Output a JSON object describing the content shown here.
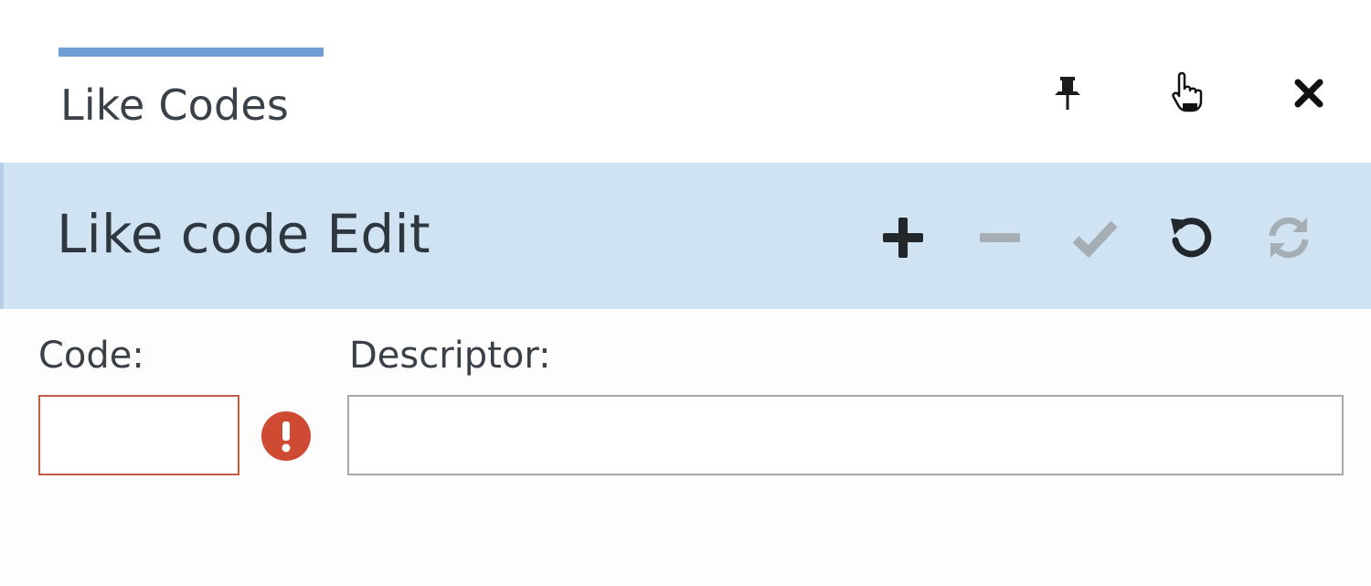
{
  "tab": {
    "label": "Like Codes",
    "accent_color": "#6e9fd3"
  },
  "window_controls": [
    {
      "name": "pin-icon"
    },
    {
      "name": "hand-cursor-icon"
    },
    {
      "name": "close-icon"
    }
  ],
  "panel": {
    "title": "Like code Edit",
    "background": "#cfe3f3",
    "toolbar": [
      {
        "name": "add-icon",
        "enabled": true
      },
      {
        "name": "remove-icon",
        "enabled": false
      },
      {
        "name": "save-check-icon",
        "enabled": false
      },
      {
        "name": "undo-icon",
        "enabled": true
      },
      {
        "name": "refresh-icon",
        "enabled": false
      }
    ]
  },
  "form": {
    "code": {
      "label": "Code:",
      "value": "",
      "error": true,
      "error_color": "#cf4a32"
    },
    "descriptor": {
      "label": "Descriptor:",
      "value": ""
    }
  }
}
